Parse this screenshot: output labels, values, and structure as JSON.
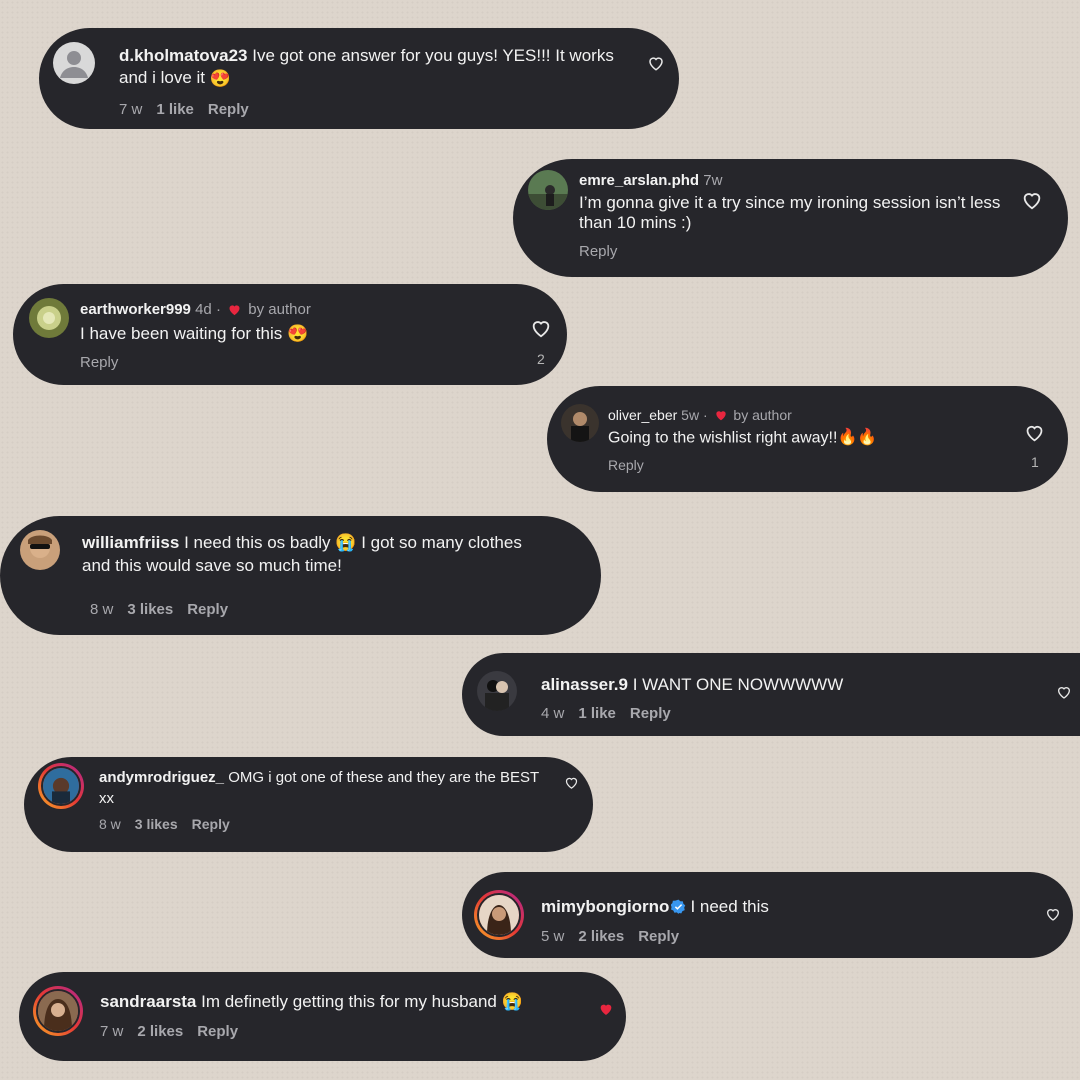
{
  "comments": [
    {
      "user": "d.kholmatova23",
      "text": "Ive got one answer for you guys! YES!!! It works and i love it",
      "emoji": "😍",
      "time": "7 w",
      "likes": "1 like",
      "reply": "Reply"
    },
    {
      "user": "emre_arslan.phd",
      "time": "7w",
      "text": "I’m gonna give it a try since my ironing session isn’t less than 10 mins :)",
      "reply": "Reply"
    },
    {
      "user": "earthworker999",
      "time": "4d",
      "by_author": "by author",
      "text": "I have been waiting for this",
      "emoji": "😍",
      "reply": "Reply",
      "like_count": "2"
    },
    {
      "user": "oliver_eber",
      "time": "5w",
      "by_author": "by author",
      "text": "Going to the wishlist right away!!",
      "emoji": "🔥🔥",
      "reply": "Reply",
      "like_count": "1"
    },
    {
      "user": "williamfriiss",
      "text": "I need this os badly",
      "emoji": "😭",
      "text2": "I got so many clothes and this would save so much time!",
      "time": "8 w",
      "likes": "3 likes",
      "reply": "Reply"
    },
    {
      "user": "alinasser.9",
      "text": "I WANT ONE NOWWWWW",
      "time": "4 w",
      "likes": "1 like",
      "reply": "Reply"
    },
    {
      "user": "andymrodriguez_",
      "text": "OMG i got one of these and they are the BEST xx",
      "time": "8 w",
      "likes": "3 likes",
      "reply": "Reply"
    },
    {
      "user": "mimybongiorno",
      "text": "I need this",
      "time": "5 w",
      "likes": "2 likes",
      "reply": "Reply"
    },
    {
      "user": "sandraarsta",
      "text": "Im definetly getting this for my husband",
      "emoji": "😭",
      "time": "7 w",
      "likes": "2 likes",
      "reply": "Reply"
    }
  ],
  "colors": {
    "bubble": "#26262b",
    "meta": "#a8a8ad",
    "liked_heart": "#e8263f",
    "background": "#ddd5cc"
  },
  "icons": {
    "like": "heart-outline-icon",
    "liked": "heart-filled-icon",
    "verified": "verified-badge-icon",
    "author_heart": "heart-filled-icon"
  }
}
